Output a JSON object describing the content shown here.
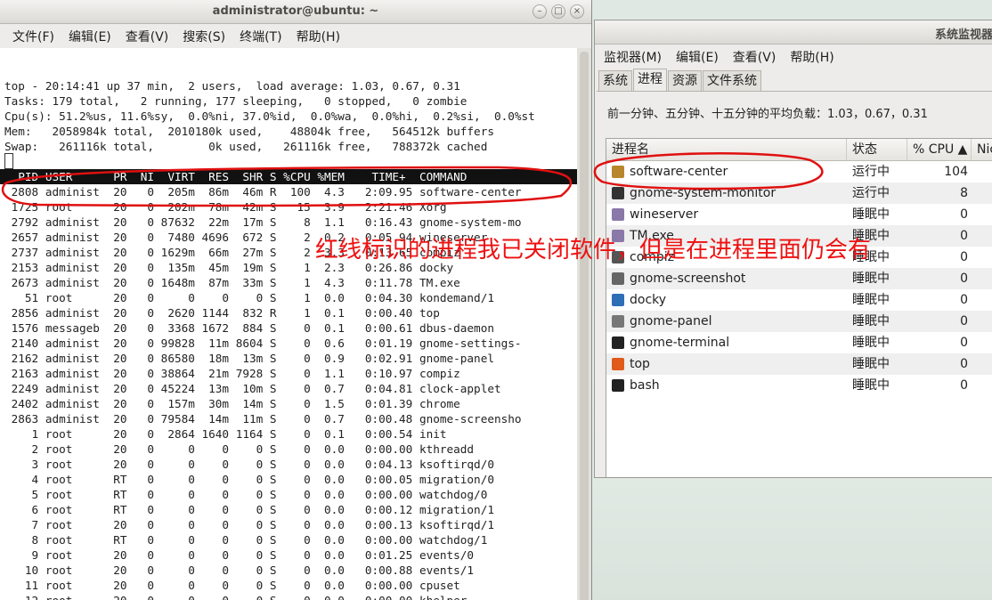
{
  "terminal": {
    "title": "administrator@ubuntu: ~",
    "menu": [
      "文件(F)",
      "编辑(E)",
      "查看(V)",
      "搜索(S)",
      "终端(T)",
      "帮助(H)"
    ],
    "summary": [
      "top - 20:14:41 up 37 min,  2 users,  load average: 1.03, 0.67, 0.31",
      "Tasks: 179 total,   2 running, 177 sleeping,   0 stopped,   0 zombie",
      "Cpu(s): 51.2%us, 11.6%sy,  0.0%ni, 37.0%id,  0.0%wa,  0.0%hi,  0.2%si,  0.0%st",
      "Mem:   2058984k total,  2010180k used,    48804k free,   564512k buffers",
      "Swap:   261116k total,        0k used,   261116k free,   788372k cached"
    ],
    "header": "  PID USER      PR  NI  VIRT  RES  SHR S %CPU %MEM    TIME+  COMMAND",
    "rows": [
      " 2808 administ  20   0  205m  86m  46m R  100  4.3   2:09.95 software-center",
      " 1725 root      20   0  202m  78m  42m S   15  3.9   2:21.46 Xorg",
      " 2792 administ  20   0 87632  22m  17m S    8  1.1   0:16.43 gnome-system-mo",
      " 2657 administ  20   0  7480 4696  672 S    2  0.2   0:05.94 wineserver",
      " 2737 administ  20   0 1629m  66m  27m S    2  3.3   0:13.65 compiz",
      " 2153 administ  20   0  135m  45m  19m S    1  2.3   0:26.86 docky",
      " 2673 administ  20   0 1648m  87m  33m S    1  4.3   0:11.78 TM.exe",
      "   51 root      20   0     0    0    0 S    1  0.0   0:04.30 kondemand/1",
      " 2856 administ  20   0  2620 1144  832 R    1  0.1   0:00.40 top",
      " 1576 messageb  20   0  3368 1672  884 S    0  0.1   0:00.61 dbus-daemon",
      " 2140 administ  20   0 99828  11m 8604 S    0  0.6   0:01.19 gnome-settings-",
      " 2162 administ  20   0 86580  18m  13m S    0  0.9   0:02.91 gnome-panel",
      " 2163 administ  20   0 38864  21m 7928 S    0  1.1   0:10.97 compiz",
      " 2249 administ  20   0 45224  13m  10m S    0  0.7   0:04.81 clock-applet",
      " 2402 administ  20   0  157m  30m  14m S    0  1.5   0:01.39 chrome",
      " 2863 administ  20   0 79584  14m  11m S    0  0.7   0:00.48 gnome-screensho",
      "    1 root      20   0  2864 1640 1164 S    0  0.1   0:00.54 init",
      "    2 root      20   0     0    0    0 S    0  0.0   0:00.00 kthreadd",
      "    3 root      20   0     0    0    0 S    0  0.0   0:04.13 ksoftirqd/0",
      "    4 root      RT   0     0    0    0 S    0  0.0   0:00.05 migration/0",
      "    5 root      RT   0     0    0    0 S    0  0.0   0:00.00 watchdog/0",
      "    6 root      RT   0     0    0    0 S    0  0.0   0:00.12 migration/1",
      "    7 root      20   0     0    0    0 S    0  0.0   0:00.13 ksoftirqd/1",
      "    8 root      RT   0     0    0    0 S    0  0.0   0:00.00 watchdog/1",
      "    9 root      20   0     0    0    0 S    0  0.0   0:01.25 events/0",
      "   10 root      20   0     0    0    0 S    0  0.0   0:00.88 events/1",
      "   11 root      20   0     0    0    0 S    0  0.0   0:00.00 cpuset",
      "   12 root      20   0     0    0    0 S    0  0.0   0:00.00 khelper"
    ]
  },
  "sysmon": {
    "title": "系统监视器",
    "menu": [
      "监视器(M)",
      "编辑(E)",
      "查看(V)",
      "帮助(H)"
    ],
    "tabs": [
      "系统",
      "进程",
      "资源",
      "文件系统"
    ],
    "active_tab": "进程",
    "load_avg": "前一分钟、五分钟、十五分钟的平均负载：1.03，0.67，0.31",
    "columns": {
      "name": "进程名",
      "state": "状态",
      "cpu": "% CPU ▲",
      "nice": "Nic"
    },
    "processes": [
      {
        "name": "software-center",
        "state": "运行中",
        "cpu": "104",
        "icon": "software-center-icon",
        "color": "#b8862b"
      },
      {
        "name": "gnome-system-monitor",
        "state": "运行中",
        "cpu": "8",
        "icon": "system-monitor-icon",
        "color": "#333333"
      },
      {
        "name": "wineserver",
        "state": "睡眠中",
        "cpu": "0",
        "icon": "wine-icon",
        "color": "#8a78a8"
      },
      {
        "name": "TM.exe",
        "state": "睡眠中",
        "cpu": "0",
        "icon": "wine-icon",
        "color": "#8a78a8"
      },
      {
        "name": "compiz",
        "state": "睡眠中",
        "cpu": "0",
        "icon": "compiz-icon",
        "color": "#555555"
      },
      {
        "name": "gnome-screenshot",
        "state": "睡眠中",
        "cpu": "0",
        "icon": "camera-icon",
        "color": "#666666"
      },
      {
        "name": "docky",
        "state": "睡眠中",
        "cpu": "0",
        "icon": "docky-icon",
        "color": "#2f6fb5"
      },
      {
        "name": "gnome-panel",
        "state": "睡眠中",
        "cpu": "0",
        "icon": "panel-icon",
        "color": "#777777"
      },
      {
        "name": "gnome-terminal",
        "state": "睡眠中",
        "cpu": "0",
        "icon": "terminal-icon",
        "color": "#222222"
      },
      {
        "name": "top",
        "state": "睡眠中",
        "cpu": "0",
        "icon": "top-icon",
        "color": "#e05a1a"
      },
      {
        "name": "bash",
        "state": "睡眠中",
        "cpu": "0",
        "icon": "terminal-icon",
        "color": "#222222"
      }
    ]
  },
  "annotation": {
    "text": "红线标识的进程我已关闭软件，但是在进程里面仍会有",
    "color": "#ee1111"
  }
}
